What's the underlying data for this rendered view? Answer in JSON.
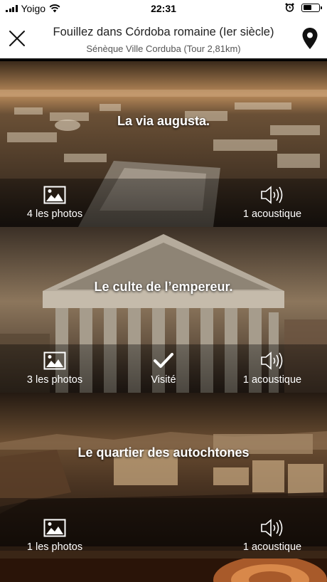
{
  "status_bar": {
    "carrier": "Yoigo",
    "time": "22:31",
    "battery_level": 0.55,
    "icons": [
      "signal-icon",
      "wifi-icon",
      "alarm-icon",
      "battery-icon"
    ]
  },
  "header": {
    "title": "Fouillez dans Córdoba romaine (Ier siècle)",
    "subtitle": "Sénèque Ville Corduba (Tour 2,81km)",
    "close_icon": "close-icon",
    "map_icon": "map-pin-icon"
  },
  "cards": [
    {
      "title": "La via augusta.",
      "photos_label": "4 les photos",
      "audio_label": "1 acoustique",
      "visited": false
    },
    {
      "title": "Le culte de l’empereur.",
      "photos_label": "3 les photos",
      "visited_label": "Visité",
      "audio_label": "1 acoustique",
      "visited": true
    },
    {
      "title": "Le quartier des autochtones",
      "photos_label": "1 les photos",
      "audio_label": "1 acoustique",
      "visited": false
    }
  ]
}
